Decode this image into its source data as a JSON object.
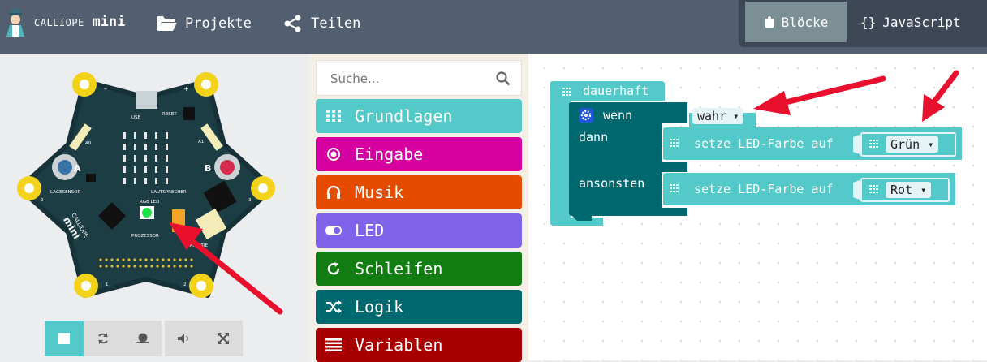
{
  "header": {
    "logo_small": "CALLIOPE",
    "logo_big": "mini",
    "nav_projects": "Projekte",
    "nav_share": "Teilen",
    "tab_blocks": "Blöcke",
    "tab_javascript": "JavaScript",
    "js_braces": "{}"
  },
  "board": {
    "brand_small": "CALLIOPE",
    "brand_big": "mini",
    "label_usb": "USB",
    "label_reset": "RESET",
    "label_a8": "A0",
    "label_a1": "A1",
    "label_a": "A",
    "label_b": "B",
    "label_lagesensor": "LAGESENSOR",
    "label_lautsprecher": "LAUTSPRECHER",
    "label_rgb": "RGB LED",
    "label_prozessor": "PROZESSOR",
    "label_batterie": "BATTERIE",
    "label_minus": "–",
    "label_plus": "+",
    "pin_0": "0",
    "pin_1": "1",
    "pin_2": "2",
    "pin_3": "3"
  },
  "toolbox": {
    "search_placeholder": "Suche...",
    "categories": [
      {
        "label": "Grundlagen",
        "color": "#54c9c9"
      },
      {
        "label": "Eingabe",
        "color": "#d400a0"
      },
      {
        "label": "Musik",
        "color": "#e64c00"
      },
      {
        "label": "LED",
        "color": "#7e62e8"
      },
      {
        "label": "Schleifen",
        "color": "#127d12"
      },
      {
        "label": "Logik",
        "color": "#006970"
      },
      {
        "label": "Variablen",
        "color": "#a80000"
      }
    ]
  },
  "workspace": {
    "forever_label": "dauerhaft",
    "if_label": "wenn",
    "condition_value": "wahr",
    "then_label": "dann",
    "else_label": "ansonsten",
    "set_led_label": "setze LED-Farbe auf",
    "color_then": "Grün",
    "color_else": "Rot",
    "dropdown_arrow": "▾"
  },
  "colors": {
    "header_bg": "#525f70",
    "basic_block": "#54c9c9",
    "logic_block": "#006970",
    "annotation_arrow": "#e8102d"
  }
}
